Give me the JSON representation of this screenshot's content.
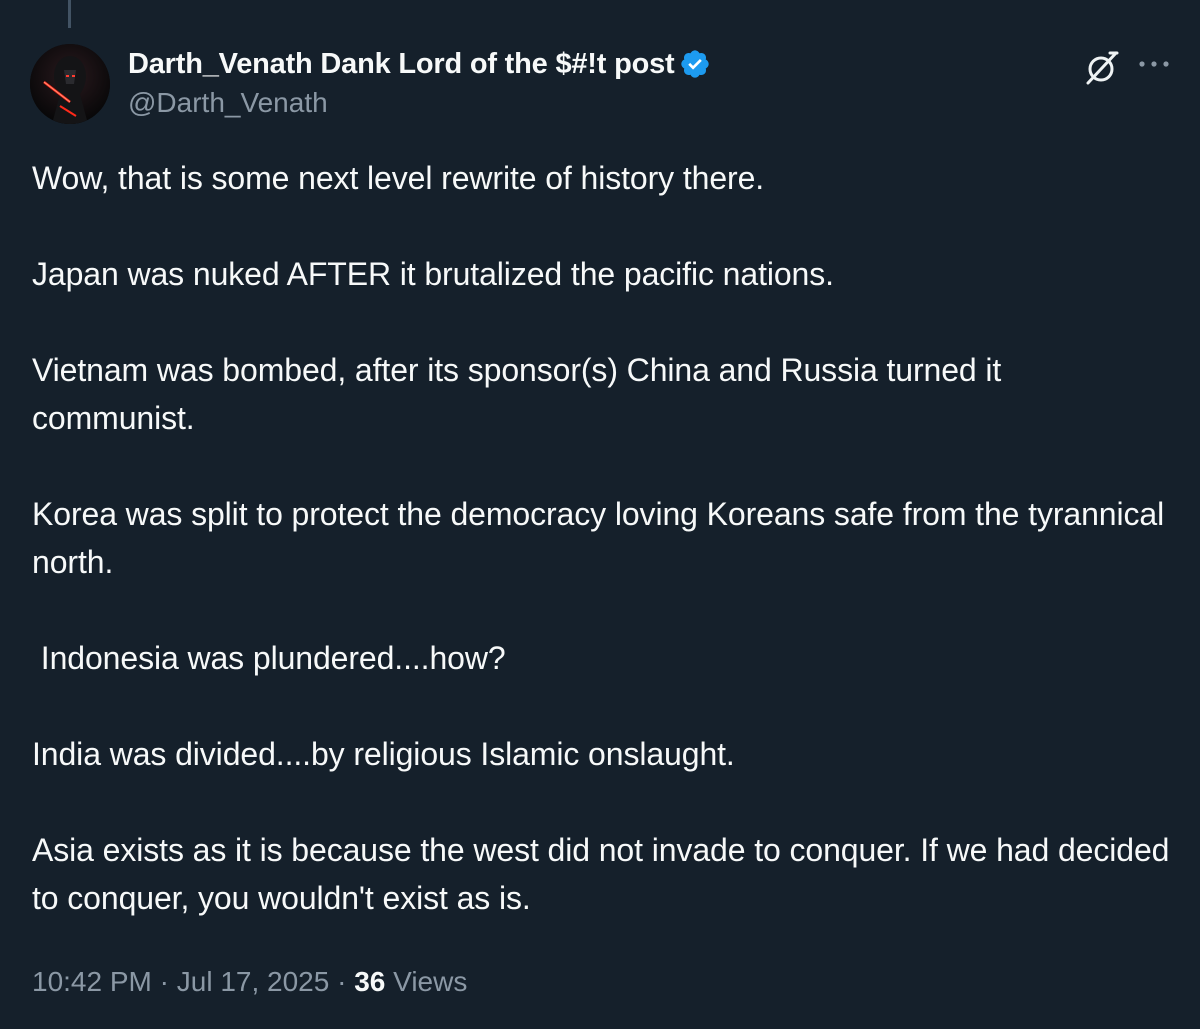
{
  "author": {
    "display_name": "Darth_Venath Dank Lord of the $#!t post",
    "handle": "@Darth_Venath",
    "verified": true,
    "verified_color": "#1d9bf0"
  },
  "actions": {
    "grok_icon": "grok-icon",
    "more_icon": "more-icon"
  },
  "tweet": {
    "paragraphs": [
      "Wow, that is some next level rewrite of history there.",
      "Japan was nuked AFTER it brutalized the pacific nations.",
      "Vietnam was bombed, after its sponsor(s) China and Russia turned it communist.",
      "Korea was split to protect the democracy loving Koreans safe from the tyrannical north.",
      " Indonesia was plundered....how?",
      "India was divided....by religious Islamic onslaught.",
      "Asia exists as it is because the west did not invade to conquer. If we had decided to conquer, you wouldn't exist as is."
    ]
  },
  "meta": {
    "time": "10:42 PM",
    "separator": " · ",
    "date": "Jul 17, 2025",
    "views_count": "36",
    "views_label": "Views"
  },
  "colors": {
    "background": "#15202b",
    "text_primary": "#f7f9f9",
    "text_secondary": "#8b98a5",
    "thread_line": "#425364"
  }
}
